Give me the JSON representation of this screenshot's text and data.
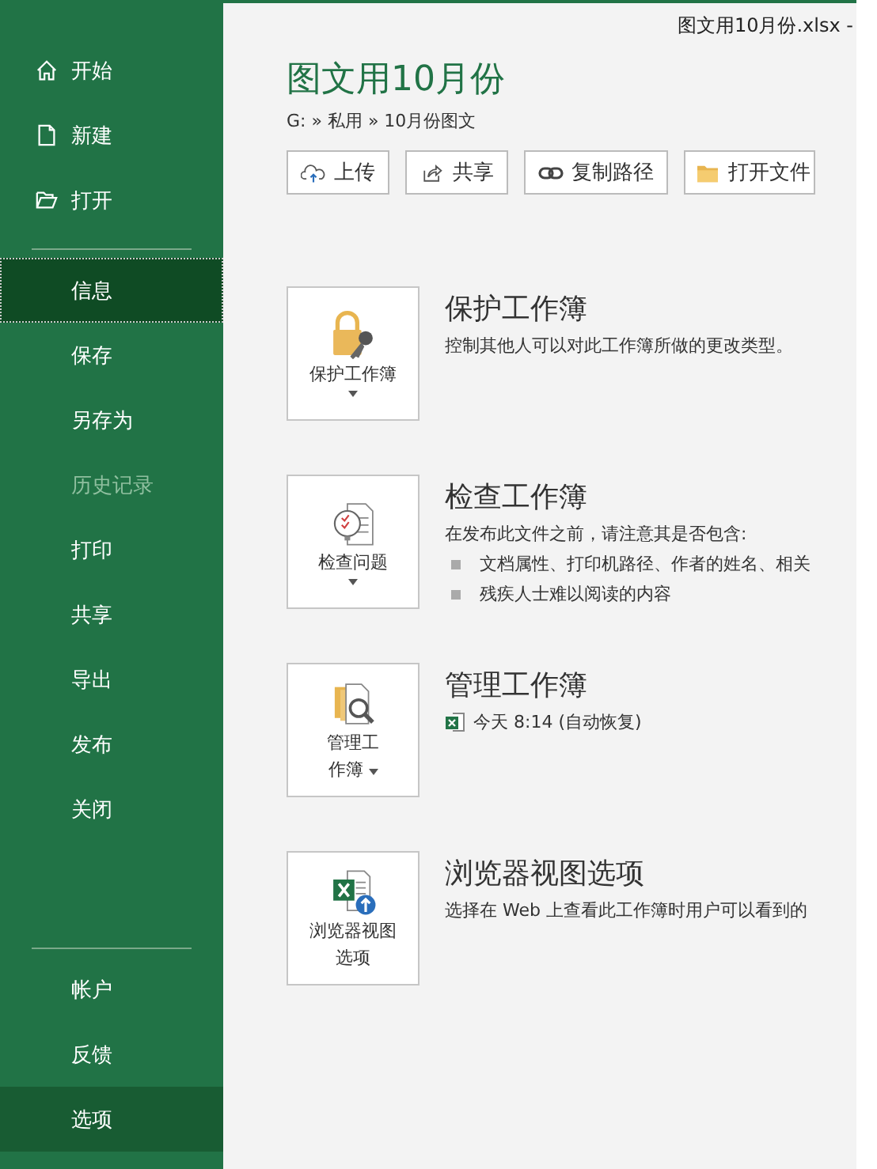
{
  "window": {
    "title": "图文用10月份.xlsx -"
  },
  "sidebar": {
    "top_items": [
      {
        "label": "开始",
        "selected": false,
        "disabled": false,
        "hovered": false
      },
      {
        "label": "新建",
        "selected": false,
        "disabled": false,
        "hovered": false
      },
      {
        "label": "打开",
        "selected": false,
        "disabled": false,
        "hovered": false
      }
    ],
    "items": [
      {
        "label": "信息",
        "selected": true,
        "disabled": false,
        "hovered": false
      },
      {
        "label": "保存",
        "selected": false,
        "disabled": false,
        "hovered": false
      },
      {
        "label": "另存为",
        "selected": false,
        "disabled": false,
        "hovered": false
      },
      {
        "label": "历史记录",
        "selected": false,
        "disabled": true,
        "hovered": false
      },
      {
        "label": "打印",
        "selected": false,
        "disabled": false,
        "hovered": false
      },
      {
        "label": "共享",
        "selected": false,
        "disabled": false,
        "hovered": false
      },
      {
        "label": "导出",
        "selected": false,
        "disabled": false,
        "hovered": false
      },
      {
        "label": "发布",
        "selected": false,
        "disabled": false,
        "hovered": false
      },
      {
        "label": "关闭",
        "selected": false,
        "disabled": false,
        "hovered": false
      }
    ],
    "bottom_items": [
      {
        "label": "帐户",
        "selected": false,
        "disabled": false,
        "hovered": false
      },
      {
        "label": "反馈",
        "selected": false,
        "disabled": false,
        "hovered": false
      },
      {
        "label": "选项",
        "selected": false,
        "disabled": false,
        "hovered": true
      }
    ]
  },
  "info": {
    "title": "图文用10月份",
    "path": "G: » 私用 » 10月份图文",
    "actions": [
      {
        "label": "上传"
      },
      {
        "label": "共享"
      },
      {
        "label": "复制路径"
      },
      {
        "label": "打开文件"
      }
    ],
    "sections": [
      {
        "kind": "protect",
        "button_lines": [
          "保护工作簿"
        ],
        "dropdown": true,
        "heading": "保护工作簿",
        "description": "控制其他人可以对此工作簿所做的更改类型。"
      },
      {
        "kind": "inspect",
        "button_lines": [
          "检查问题"
        ],
        "dropdown": true,
        "heading": "检查工作簿",
        "description": "在发布此文件之前，请注意其是否包含:",
        "bullets": [
          "文档属性、打印机路径、作者的姓名、相关",
          "残疾人士难以阅读的内容"
        ]
      },
      {
        "kind": "manage",
        "button_lines": [
          "管理工",
          "作簿"
        ],
        "dropdown": true,
        "heading": "管理工作簿",
        "versions": [
          "今天 8:14 (自动恢复)"
        ]
      },
      {
        "kind": "browser",
        "button_lines": [
          "浏览器视图",
          "选项"
        ],
        "dropdown": false,
        "heading": "浏览器视图选项",
        "description": "选择在 Web 上查看此工作簿时用户可以看到的"
      }
    ]
  }
}
